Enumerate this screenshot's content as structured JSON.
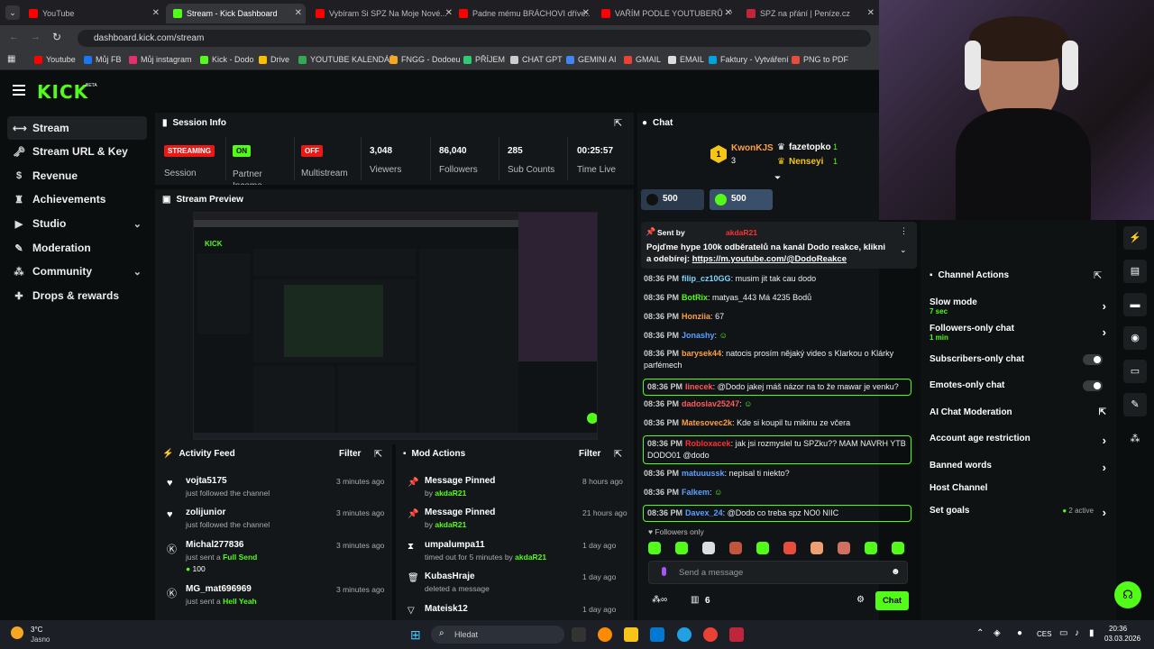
{
  "browser": {
    "tabs": [
      "YouTube",
      "Stream - Kick Dashboard",
      "Vybíram Si SPZ Na Moje Nové...",
      "Padne mému BRÁCHOVI dříve...",
      "VAŘÍM PODLE YOUTUBERŮ - Yo...",
      "SPZ na přání | Peníze.cz"
    ],
    "url": "dashboard.kick.com/stream",
    "bookmarks": [
      "Youtube",
      "Můj FB",
      "Můj instagram",
      "Kick - Dodo",
      "Drive",
      "YOUTUBE KALENDÁŘ",
      "FNGG - Dodoeu",
      "PŘÍJEM",
      "CHAT GPT",
      "GEMINI AI",
      "GMAIL",
      "EMAIL",
      "Faktury - Vytváření",
      "PNG to PDF"
    ]
  },
  "brand": {
    "logo": "KICK",
    "beta": "BETA",
    "accent": "#53fc18"
  },
  "sidebar": {
    "items": [
      {
        "label": "Stream",
        "icon": "link-icon"
      },
      {
        "label": "Stream URL & Key",
        "icon": "key-icon"
      },
      {
        "label": "Revenue",
        "icon": "dollar-icon"
      },
      {
        "label": "Achievements",
        "icon": "trophy-icon"
      },
      {
        "label": "Studio",
        "icon": "video-icon"
      },
      {
        "label": "Moderation",
        "icon": "wrench-icon"
      },
      {
        "label": "Community",
        "icon": "users-icon"
      },
      {
        "label": "Drops & rewards",
        "icon": "gift-icon"
      }
    ]
  },
  "session": {
    "title": "Session Info",
    "streaming": "STREAMING",
    "session_label": "Session",
    "partner_badge": "ON",
    "partner_label": "Partner Income",
    "multistream_badge": "OFF",
    "multistream_label": "Multistream",
    "viewers": "3,048",
    "viewers_label": "Viewers",
    "followers": "86,040",
    "followers_label": "Followers",
    "subs": "285",
    "subs_label": "Sub Counts",
    "time": "00:25:57",
    "time_label": "Time Live"
  },
  "preview": {
    "title": "Stream Preview"
  },
  "activity": {
    "title": "Activity Feed",
    "filter": "Filter",
    "items": [
      {
        "name": "vojta5175",
        "sub": "just followed the channel",
        "time": "3 minutes ago"
      },
      {
        "name": "zolijunior",
        "sub": "just followed the channel",
        "time": "3 minutes ago"
      },
      {
        "name": "Michal277836",
        "sub_pre": "just sent a ",
        "sub_hl": "Full Send",
        "amount": "100",
        "time": "3 minutes ago"
      },
      {
        "name": "MG_mat696969",
        "sub_pre": "just sent a ",
        "sub_hl": "Hell Yeah",
        "time": "3 minutes ago"
      }
    ]
  },
  "mod": {
    "title": "Mod Actions",
    "filter": "Filter",
    "items": [
      {
        "name": "Message Pinned",
        "sub_pre": "by ",
        "sub_hl": "akdaR21",
        "time": "8 hours ago"
      },
      {
        "name": "Message Pinned",
        "sub_pre": "by ",
        "sub_hl": "akdaR21",
        "time": "21 hours ago"
      },
      {
        "name": "umpalumpa11",
        "sub_pre": "timed out for 5 minutes by ",
        "sub_hl": "akdaR21",
        "time": "1 day ago"
      },
      {
        "name": "KubasHraje",
        "sub_pre": "deleted a message",
        "sub_hl": "",
        "time": "1 day ago"
      },
      {
        "name": "Mateisk12",
        "sub_pre": "",
        "sub_hl": "",
        "time": "1 day ago"
      }
    ]
  },
  "chat": {
    "title": "Chat",
    "leaders": [
      {
        "rank": "1",
        "name": "KwonKJS",
        "count": "3"
      },
      {
        "name": "fazetopko",
        "count": "1"
      },
      {
        "name": "Nenseyi",
        "count": "1"
      }
    ],
    "gift1": "500",
    "gift2": "500",
    "pinned_by": "Sent by",
    "pinned_user": "akdaR21",
    "pinned_text": "Pojďme hype 100k odběratelů na kanál Dodo reakce, klikni a odebírej: ",
    "pinned_link": "https://m.youtube.com/@DodoReakce",
    "messages": [
      {
        "time": "08:36 PM",
        "user": "filip_cz10GG",
        "color": "#7fd6ff",
        "text": "musim jit tak cau dodo"
      },
      {
        "time": "08:36 PM",
        "user": "BotRix",
        "color": "#53fc18",
        "text": "matyas_443 Má 4235 Bodů"
      },
      {
        "time": "08:36 PM",
        "user": "Honziia",
        "color": "#ff9f43",
        "text": "67"
      },
      {
        "time": "08:36 PM",
        "user": "Jonashy",
        "color": "#5aa0ff",
        "text": ""
      },
      {
        "time": "08:36 PM",
        "user": "barysek44",
        "color": "#ff9f43",
        "text": "natocis prosím nějaký video s Klarkou o Klárky parfémech"
      },
      {
        "time": "08:36 PM",
        "user": "linecek",
        "color": "#ff5b5b",
        "text": "@Dodo jakej máš názor na to že mawar je venku?"
      },
      {
        "time": "08:36 PM",
        "user": "dadoslav25247",
        "color": "#ff5b5b",
        "text": ""
      },
      {
        "time": "08:36 PM",
        "user": "Matesovec2k",
        "color": "#ff9f43",
        "text": "Kde si koupil tu mikinu ze včera"
      },
      {
        "time": "08:36 PM",
        "user": "Robloxacek",
        "color": "#ff3030",
        "text": "jak jsi rozmyslel tu SPZku?? MAM NAVRH YTB DODO01 @dodo"
      },
      {
        "time": "08:36 PM",
        "user": "matuuussk",
        "color": "#5aa0ff",
        "text": "nepisal ti niekto?"
      },
      {
        "time": "08:36 PM",
        "user": "Falkem",
        "color": "#5aa0ff",
        "text": ""
      },
      {
        "time": "08:36 PM",
        "user": "Davex_24",
        "color": "#5aa0ff",
        "text": "@Dodo co treba spz NO0 NIIC"
      }
    ],
    "followers_only": "Followers only",
    "placeholder": "Send a message",
    "viewers_count": "6",
    "send": "Chat"
  },
  "channel_actions": {
    "title": "Channel Actions",
    "rows": [
      {
        "label": "Slow mode",
        "sub": "7 sec",
        "ctrl": "chevron"
      },
      {
        "label": "Followers-only chat",
        "sub": "1 min",
        "ctrl": "chevron"
      },
      {
        "label": "Subscribers-only chat",
        "sub": "",
        "ctrl": "toggle"
      },
      {
        "label": "Emotes-only chat",
        "sub": "",
        "ctrl": "toggle"
      },
      {
        "label": "AI Chat Moderation",
        "sub": "",
        "ctrl": "external"
      },
      {
        "label": "Account age restriction",
        "sub": "",
        "ctrl": "chevron"
      },
      {
        "label": "Banned words",
        "sub": "",
        "ctrl": "chevron"
      },
      {
        "label": "Host Channel",
        "sub": "",
        "ctrl": "none"
      },
      {
        "label": "Set goals",
        "sub": "",
        "ctrl": "chevron",
        "extra": "2 active"
      }
    ]
  },
  "taskbar": {
    "weather_temp": "3°C",
    "weather_desc": "Jasno",
    "search": "Hledat",
    "lang": "CES",
    "time": "20:36",
    "date": "03.03.2026"
  }
}
